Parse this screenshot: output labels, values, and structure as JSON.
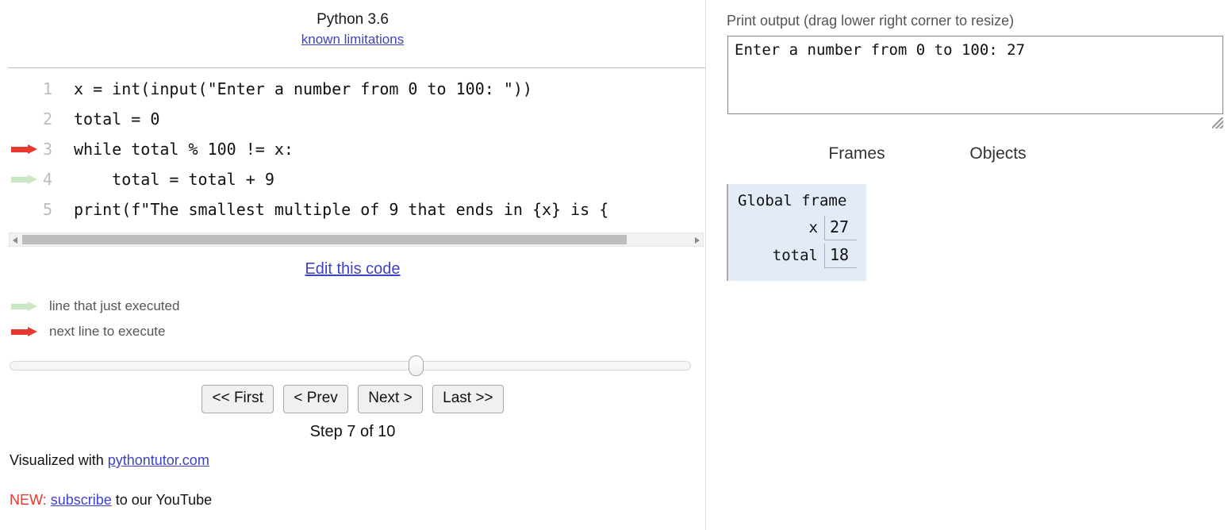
{
  "code_panel": {
    "python_version": "Python 3.6",
    "known_limitations_link": "known limitations",
    "edit_link": "Edit this code",
    "lines": [
      {
        "number": "1",
        "text": "x = int(input(\"Enter a number from 0 to 100: \"))",
        "marker": "none"
      },
      {
        "number": "2",
        "text": "total = 0",
        "marker": "none"
      },
      {
        "number": "3",
        "text": "while total % 100 != x:",
        "marker": "next"
      },
      {
        "number": "4",
        "text": "    total = total + 9",
        "marker": "executed"
      },
      {
        "number": "5",
        "text": "print(f\"The smallest multiple of 9 that ends in {x} is {",
        "marker": "none"
      }
    ]
  },
  "legend": {
    "executed_label": "line that just executed",
    "next_label": "next line to execute"
  },
  "controls": {
    "first_label": "<< First",
    "prev_label": "< Prev",
    "next_label": "Next >",
    "last_label": "Last >>",
    "step_text": "Step 7 of 10",
    "current_step": 7,
    "total_steps": 10,
    "slider_percent": 58.6
  },
  "footer": {
    "visualized_prefix": "Visualized with ",
    "visualized_link": "pythontutor.com",
    "new_tag": "NEW:",
    "subscribe_link": "subscribe",
    "subscribe_suffix": " to our YouTube"
  },
  "output": {
    "label": "Print output (drag lower right corner to resize)",
    "text": "Enter a number from 0 to 100: 27"
  },
  "visualization": {
    "frames_heading": "Frames",
    "objects_heading": "Objects",
    "global_frame": {
      "title": "Global frame",
      "variables": [
        {
          "name": "x",
          "value": "27"
        },
        {
          "name": "total",
          "value": "18"
        }
      ]
    }
  },
  "colors": {
    "next_arrow": "#e8392f",
    "executed_arrow": "#c9e8c2",
    "frame_background": "#e2ebf6",
    "link": "#3e42c6",
    "new_tag": "#e8392f"
  }
}
